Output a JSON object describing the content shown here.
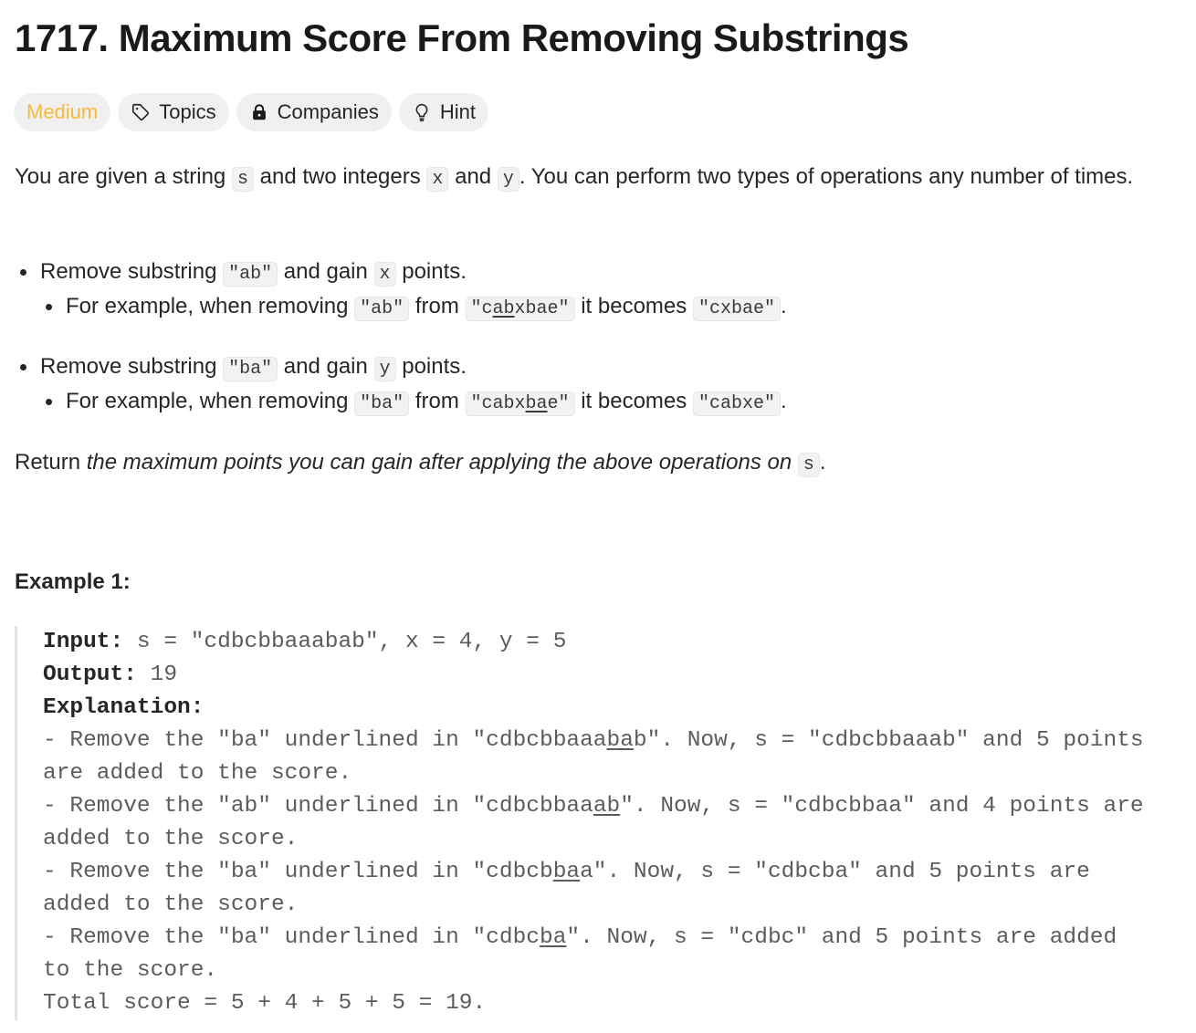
{
  "problem": {
    "title": "1717. Maximum Score From Removing Substrings",
    "difficulty": "Medium",
    "tags": {
      "topics": "Topics",
      "companies": "Companies",
      "hint": "Hint"
    },
    "icons": {
      "topics": "tag-icon",
      "companies": "lock-icon",
      "hint": "lightbulb-icon"
    },
    "colors": {
      "difficulty_medium": "#f5b93b",
      "chip_background": "#f0f0f0"
    }
  },
  "description": {
    "p1": {
      "t1": "You are given a string ",
      "c1": "s",
      "t2": " and two integers ",
      "c2": "x",
      "t3": " and ",
      "c3": "y",
      "t4": ". You can perform two types of operations any number of times."
    },
    "op1": {
      "t1": "Remove substring ",
      "c1": "\"ab\"",
      "t2": " and gain ",
      "c2": "x",
      "t3": " points.",
      "ex": {
        "t1": "For example, when removing ",
        "c1": "\"ab\"",
        "t2": " from ",
        "c2a": "\"c",
        "c2u": "ab",
        "c2b": "xbae\"",
        "t3": " it becomes ",
        "c3": "\"cxbae\"",
        "t4": "."
      }
    },
    "op2": {
      "t1": "Remove substring ",
      "c1": "\"ba\"",
      "t2": " and gain ",
      "c2": "y",
      "t3": " points.",
      "ex": {
        "t1": "For example, when removing ",
        "c1": "\"ba\"",
        "t2": " from ",
        "c2a": "\"cabx",
        "c2u": "ba",
        "c2b": "e\"",
        "t3": " it becomes ",
        "c3": "\"cabxe\"",
        "t4": "."
      }
    },
    "ret": {
      "t1": "Return ",
      "em": "the maximum points you can gain after applying the above operations on",
      "t2": " ",
      "c1": "s",
      "t3": "."
    }
  },
  "example1": {
    "heading": "Example 1:",
    "input_label": "Input:",
    "input_value": " s = \"cdbcbbaaabab\", x = 4, y = 5",
    "output_label": "Output:",
    "output_value": " 19",
    "explanation_label": "Explanation:",
    "s1a": "- Remove the \"ba\" underlined in \"cdbcbbaaa",
    "s1u": "ba",
    "s1b": "b\". Now, s = \"cdbcbbaaab\" and 5 points",
    "s1c": "are added to the score.",
    "s2a": "- Remove the \"ab\" underlined in \"cdbcbbaa",
    "s2u": "ab",
    "s2b": "\". Now, s = \"cdbcbbaa\" and 4 points are",
    "s2c": "added to the score.",
    "s3a": "- Remove the \"ba\" underlined in \"cdbcb",
    "s3u": "ba",
    "s3b": "a\". Now, s = \"cdbcba\" and 5 points are",
    "s3c": "added to the score.",
    "s4a": "- Remove the \"ba\" underlined in \"cdbc",
    "s4u": "ba",
    "s4b": "\". Now, s = \"cdbc\" and 5 points are added",
    "s4c": "to the score.",
    "total": "Total score = 5 + 4 + 5 + 5 = 19."
  }
}
